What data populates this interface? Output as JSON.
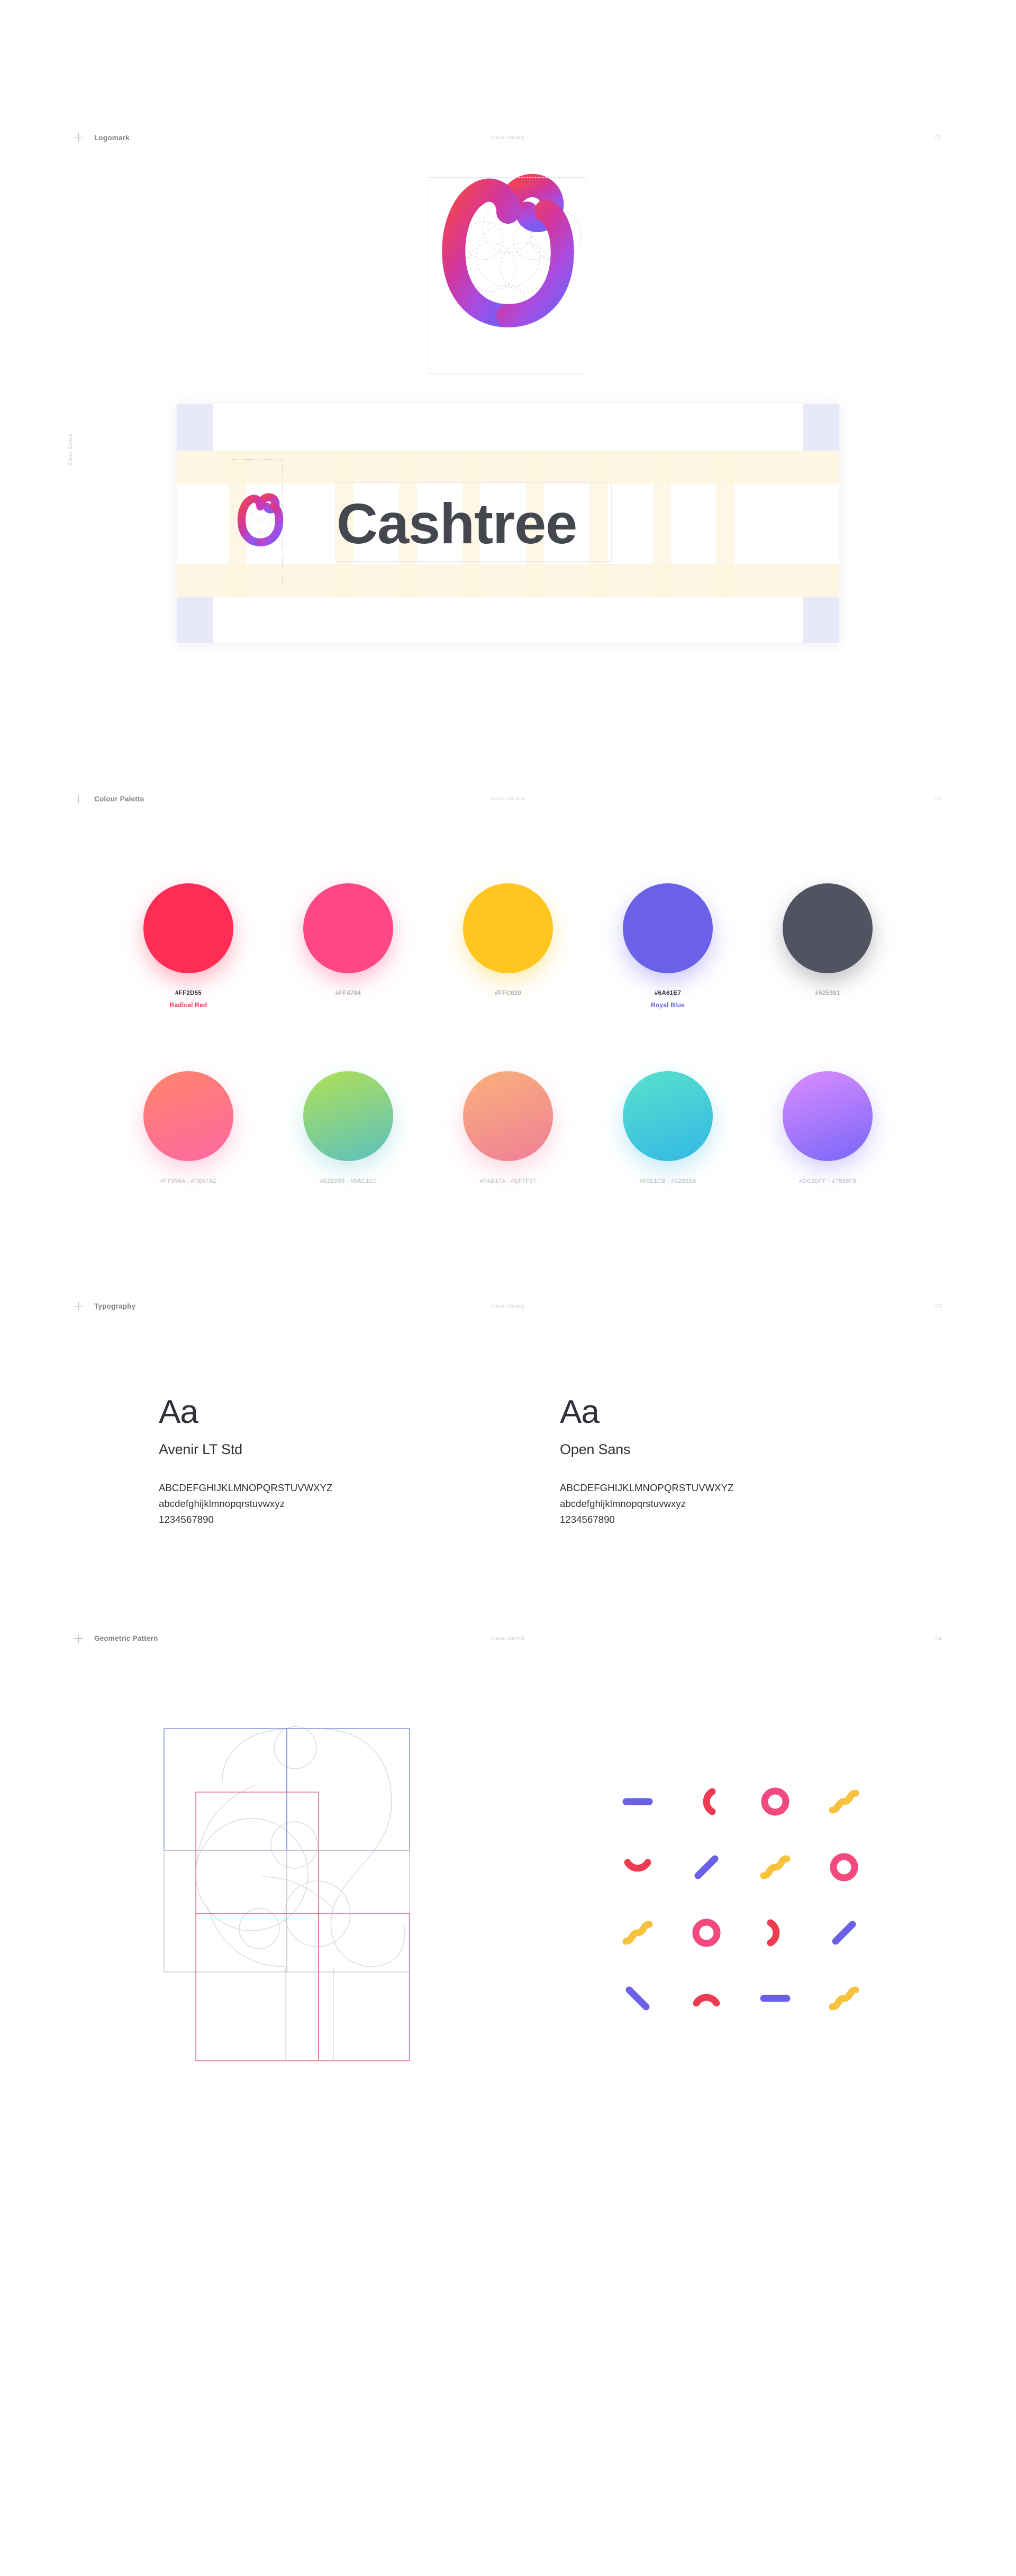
{
  "brand": {
    "name": "Cashtree"
  },
  "sections": [
    {
      "id": "logomark",
      "title": "Logomark",
      "subtitle": "Visual Identity",
      "number": "01"
    },
    {
      "id": "colour-palette",
      "title": "Colour Palette",
      "subtitle": "Visual Identity",
      "number": "02"
    },
    {
      "id": "typography",
      "title": "Typography",
      "subtitle": "Visual Identity",
      "number": "03"
    },
    {
      "id": "geometric-pattern",
      "title": "Geometric Pattern",
      "subtitle": "Visual Identity",
      "number": "04"
    }
  ],
  "clear_space": {
    "label": "Clear Space"
  },
  "palette": {
    "solid": [
      {
        "hex": "#FF2D55",
        "name": "Radical Red",
        "named": true
      },
      {
        "hex": "#FF4784",
        "name": "",
        "named": false
      },
      {
        "hex": "#FFC620",
        "name": "",
        "named": false
      },
      {
        "hex": "#6A61E7",
        "name": "Royal Blue",
        "named": true
      },
      {
        "hex": "#525361",
        "name": "",
        "named": false
      }
    ],
    "gradients": [
      {
        "label": "#FF856A - #FE67A2",
        "from": "#FF856A",
        "to": "#FE67A2"
      },
      {
        "label": "#B2E055 - #5AC1C0",
        "from": "#B2E055",
        "to": "#5AC1C0"
      },
      {
        "label": "#FAB17A - #EF7F97",
        "from": "#FAB17A",
        "to": "#EF7F97"
      },
      {
        "label": "#59E1CB - #32B8E6",
        "from": "#59E1CB",
        "to": "#32B8E6"
      },
      {
        "label": "#DC8DFF - #7866F8",
        "from": "#DC8DFF",
        "to": "#7866F8"
      }
    ]
  },
  "typography": [
    {
      "specimen": "Aa",
      "family": "Avenir LT Std",
      "uppercase": "ABCDEFGHIJKLMNOPQRSTUVWXYZ",
      "lowercase": "abcdefghijklmnopqrstuvwxyz",
      "numerals": "1234567890"
    },
    {
      "specimen": "Aa",
      "family": "Open Sans",
      "uppercase": "ABCDEFGHIJKLMNOPQRSTUVWXYZ",
      "lowercase": "abcdefghijklmnopqrstuvwxyz",
      "numerals": "1234567890"
    }
  ],
  "pattern": {
    "colors": {
      "blue": "#6A61E7",
      "red": "#EE3B52",
      "pink": "#F2497F",
      "yellow": "#F7C33F"
    },
    "cells": [
      {
        "shape": "dash-horizontal",
        "color": "#6A61E7"
      },
      {
        "shape": "arc-left",
        "color": "#EE3B52"
      },
      {
        "shape": "ring",
        "color": "#F2497F"
      },
      {
        "shape": "wave",
        "color": "#F7C33F"
      },
      {
        "shape": "arc-down",
        "color": "#EE3B52"
      },
      {
        "shape": "dash-diagonal",
        "color": "#6A61E7"
      },
      {
        "shape": "wave",
        "color": "#F7C33F"
      },
      {
        "shape": "ring",
        "color": "#F2497F"
      },
      {
        "shape": "wave",
        "color": "#F7C33F"
      },
      {
        "shape": "ring",
        "color": "#F2497F"
      },
      {
        "shape": "arc-right",
        "color": "#EE3B52"
      },
      {
        "shape": "dash-diagonal",
        "color": "#6A61E7"
      },
      {
        "shape": "dash-diagonal-back",
        "color": "#6A61E7"
      },
      {
        "shape": "arc-up",
        "color": "#EE3B52"
      },
      {
        "shape": "dash-horizontal",
        "color": "#6A61E7"
      },
      {
        "shape": "wave",
        "color": "#F7C33F"
      }
    ]
  },
  "logo_colors": {
    "top": "#F0415C",
    "mid": "#D0369E",
    "low": "#A94CE0",
    "end": "#7C5BF2"
  }
}
